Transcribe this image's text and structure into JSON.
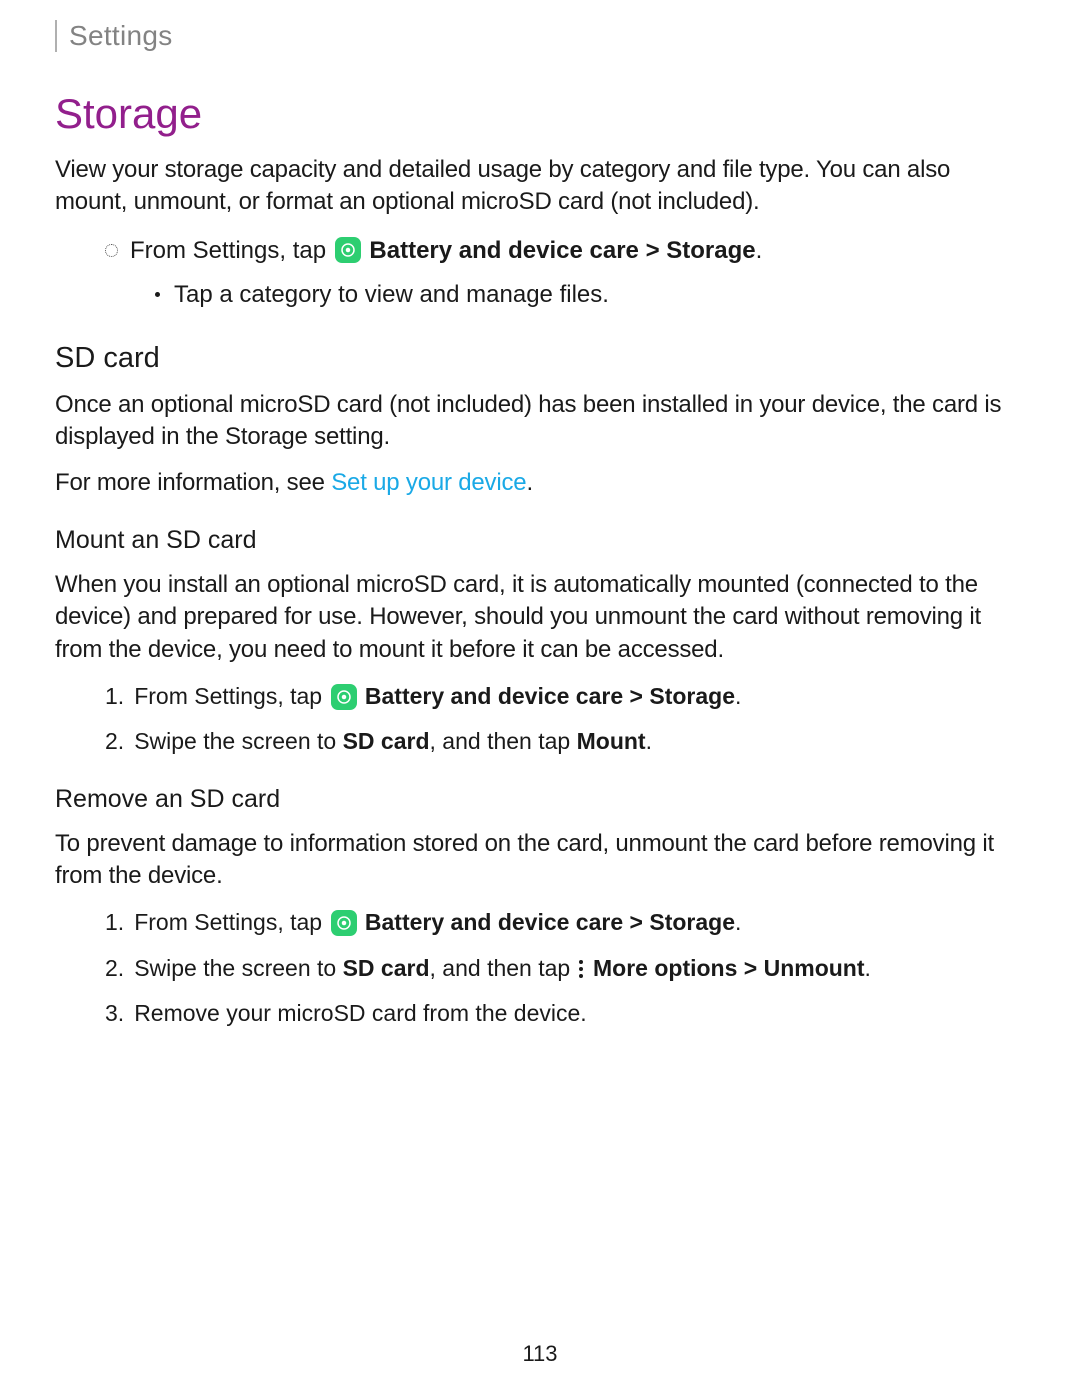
{
  "header": {
    "breadcrumb": "Settings"
  },
  "main": {
    "title": "Storage",
    "intro": "View your storage capacity and detailed usage by category and file type.  You can also mount, unmount, or format an optional microSD card (not included).",
    "nav_instruction": {
      "prefix": "From Settings, tap ",
      "bold_path": "Battery and device care > Storage",
      "suffix": "."
    },
    "nav_sub": "Tap a category to view and manage files.",
    "sd_card": {
      "title": "SD card",
      "body": "Once an optional microSD card (not included) has been installed in your device, the card is displayed in the Storage setting.",
      "more_info_prefix": "For more information, see ",
      "more_info_link": "Set up your device",
      "more_info_suffix": "."
    },
    "mount": {
      "title": "Mount an SD card",
      "body": "When you install an optional microSD card, it is automatically mounted (connected to the device) and prepared for use. However, should you unmount the card without removing it from the device, you need to mount it before it can be accessed.",
      "steps": {
        "s1_prefix": "From Settings, tap ",
        "s1_bold": "Battery and device care > Storage",
        "s1_suffix": ".",
        "s2_prefix": "Swipe the screen to ",
        "s2_bold1": "SD card",
        "s2_mid": ", and then tap ",
        "s2_bold2": "Mount",
        "s2_suffix": "."
      }
    },
    "remove": {
      "title": "Remove an SD card",
      "body": "To prevent damage to information stored on the card, unmount the card before removing it from the device.",
      "steps": {
        "s1_prefix": "From Settings, tap ",
        "s1_bold": "Battery and device care > Storage",
        "s1_suffix": ".",
        "s2_prefix": "Swipe the screen to ",
        "s2_bold1": "SD card",
        "s2_mid": ", and then tap ",
        "s2_bold2": "More options > Unmount",
        "s2_suffix": ".",
        "s3": "Remove your microSD card from the device."
      }
    }
  },
  "page_number": "113"
}
